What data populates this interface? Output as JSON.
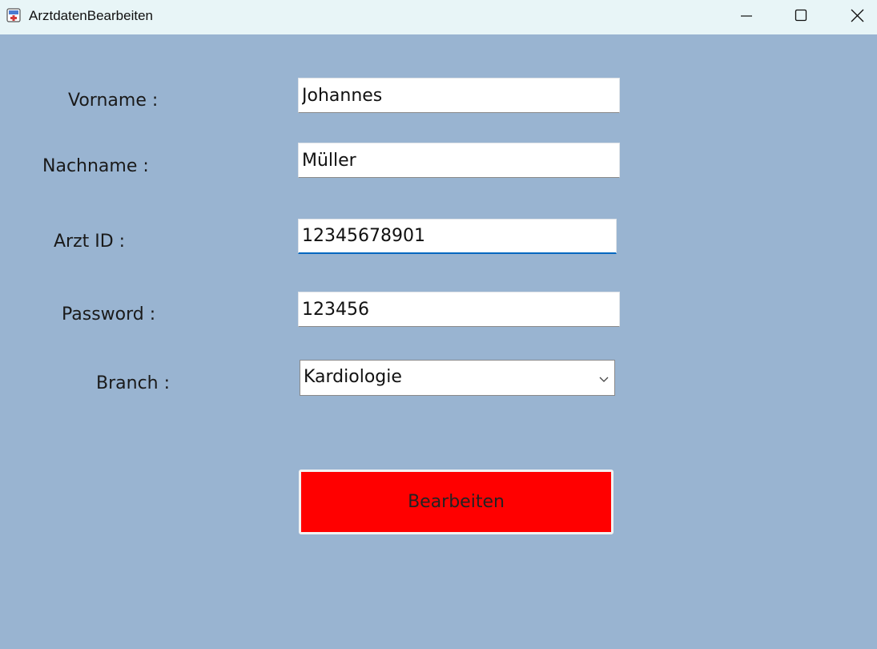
{
  "window": {
    "title": "ArztdatenBearbeiten",
    "icons": {
      "app": "app-icon",
      "minimize": "minimize-icon",
      "maximize": "maximize-icon",
      "close": "close-icon"
    },
    "colors": {
      "background": "#99b4d1",
      "titlebar": "#e8f5f7",
      "button": "#ff0000",
      "focus_accent": "#0067c0"
    }
  },
  "form": {
    "vorname": {
      "label": "Vorname :",
      "value": "Johannes"
    },
    "nachname": {
      "label": "Nachname :",
      "value": "Müller"
    },
    "arzt_id": {
      "label": "Arzt ID :",
      "value": "12345678901"
    },
    "password": {
      "label": "Password :",
      "value": "123456"
    },
    "branch": {
      "label": "Branch :",
      "selected": "Kardiologie",
      "arrow_icon": "chevron-down-icon"
    },
    "submit_label": "Bearbeiten"
  }
}
